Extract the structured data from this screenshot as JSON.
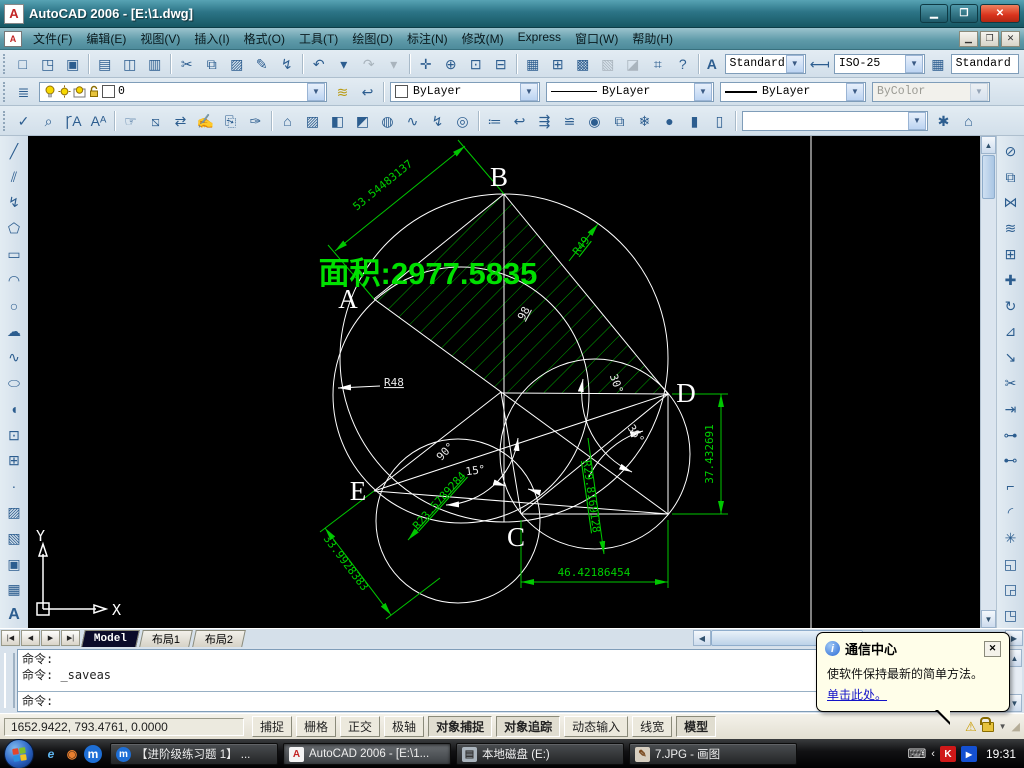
{
  "window": {
    "title": "AutoCAD 2006 - [E:\\1.dwg]"
  },
  "menu": {
    "items": [
      "文件(F)",
      "编辑(E)",
      "视图(V)",
      "插入(I)",
      "格式(O)",
      "工具(T)",
      "绘图(D)",
      "标注(N)",
      "修改(M)",
      "Express",
      "窗口(W)",
      "帮助(H)"
    ]
  },
  "toolbars": {
    "standard": {
      "icons": [
        "new-file",
        "open-file",
        "save",
        "|",
        "plot",
        "plot-preview",
        "publish",
        "|",
        "cut",
        "copy",
        "paste",
        "match-properties",
        "block-editor",
        "|",
        "undo",
        "undo-menu",
        "redo",
        "redo-menu",
        "|",
        "pan",
        "zoom-realtime",
        "zoom-window",
        "zoom-previous",
        "|",
        "properties",
        "designcenter",
        "tool-palettes",
        "sheetset-manager",
        "markup-set-manager",
        "quickcalc",
        "help"
      ]
    },
    "styles": {
      "text_style": "Standard",
      "dim_style": "ISO-25",
      "table_style": "Standard"
    },
    "layers": {
      "current_layer": "0",
      "color": "ByLayer",
      "linetype": "ByLayer",
      "lineweight": "ByLayer",
      "plot_style": "ByColor"
    },
    "row3": {
      "icons": [
        "spell-check",
        "find-replace",
        "text-style-manager",
        "scale-text",
        "|",
        "quick-select",
        "draw-order",
        "layer-translate",
        "edit-attribute",
        "attach-xref",
        "markup-pen",
        "|",
        "named-views",
        "hatch-edit",
        "image-adjust",
        "image-clip",
        "web-browse",
        "polyline-edit",
        "quick-modify",
        "group-objects",
        "|",
        "layer-states",
        "layer-previous",
        "layer-walk",
        "layer-match",
        "layer-isolate",
        "layer-copy",
        "freeze-layer",
        "layer-on-off",
        "lock-layer",
        "unlock-layer"
      ],
      "workspace_value": ""
    },
    "draw": {
      "icons": [
        "line",
        "construction-line",
        "polyline",
        "polygon",
        "rectangle",
        "arc",
        "circle",
        "revision-cloud",
        "spline",
        "ellipse",
        "ellipse-arc",
        "insert-block",
        "make-block",
        "point",
        "hatch",
        "gradient",
        "region",
        "table",
        "multiline-text"
      ]
    },
    "modify": {
      "icons": [
        "erase",
        "copy-object",
        "mirror",
        "offset",
        "array",
        "move",
        "rotate",
        "scale",
        "stretch",
        "trim",
        "extend",
        "break-at-point",
        "break",
        "chamfer",
        "fillet",
        "explode",
        "draw-order-front",
        "draw-order-back",
        "draw-order-above"
      ]
    }
  },
  "drawing": {
    "area_label": "面积:2977.5835",
    "labels": {
      "a": "A",
      "b": "B",
      "c": "C",
      "d": "D",
      "e": "E"
    },
    "dims": {
      "ab": "53.54483137",
      "r49": "R49",
      "r48": "R48",
      "d98": "98",
      "right_v": "37.432691",
      "bottom_h": "46.42186454",
      "e_align": "33.9928383",
      "r23": "R23.5789284",
      "r29": "R29.8169128",
      "a90": "90°",
      "a15": "15°",
      "a30": "30°",
      "a36": "36°"
    },
    "ucs": {
      "x": "X",
      "y": "Y"
    },
    "colors": {
      "dim_green": "#00c800",
      "area_green": "#00e000",
      "line_white": "#ffffff"
    }
  },
  "layout_tabs": {
    "tabs": [
      "Model",
      "布局1",
      "布局2"
    ],
    "active": "Model"
  },
  "command": {
    "lines": [
      "命令:",
      "命令: _saveas",
      "命令:"
    ]
  },
  "status": {
    "coords": "1652.9422, 793.4761, 0.0000",
    "buttons": [
      {
        "label": "捕捉",
        "on": false
      },
      {
        "label": "栅格",
        "on": false
      },
      {
        "label": "正交",
        "on": false
      },
      {
        "label": "极轴",
        "on": false
      },
      {
        "label": "对象捕捉",
        "on": true
      },
      {
        "label": "对象追踪",
        "on": true
      },
      {
        "label": "动态输入",
        "on": false
      },
      {
        "label": "线宽",
        "on": false
      },
      {
        "label": "模型",
        "on": true
      }
    ]
  },
  "balloon": {
    "title": "通信中心",
    "message": "使软件保持最新的简单方法。",
    "link": "单击此处。"
  },
  "taskbar": {
    "quick_launch": [
      "internet-explorer-icon",
      "media-player-icon",
      "storm-player-icon"
    ],
    "tasks": [
      {
        "icon": "storm-player-icon",
        "label": "【进阶级练习题 1】 ...",
        "active": false
      },
      {
        "icon": "autocad-icon",
        "label": "AutoCAD 2006 - [E:\\1...",
        "active": true
      },
      {
        "icon": "disk-drive-icon",
        "label": "本地磁盘 (E:)",
        "active": false
      },
      {
        "icon": "paint-icon",
        "label": "7.JPG - 画图",
        "active": false
      }
    ],
    "clock": "19:31"
  }
}
